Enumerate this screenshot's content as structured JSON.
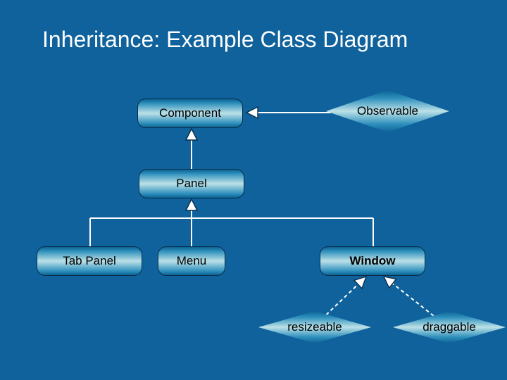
{
  "title": "Inheritance: Example Class Diagram",
  "nodes": {
    "component": "Component",
    "observable": "Observable",
    "panel": "Panel",
    "tab_panel": "Tab Panel",
    "menu": "Menu",
    "window": "Window",
    "resizeable": "resizeable",
    "draggable": "draggable"
  }
}
